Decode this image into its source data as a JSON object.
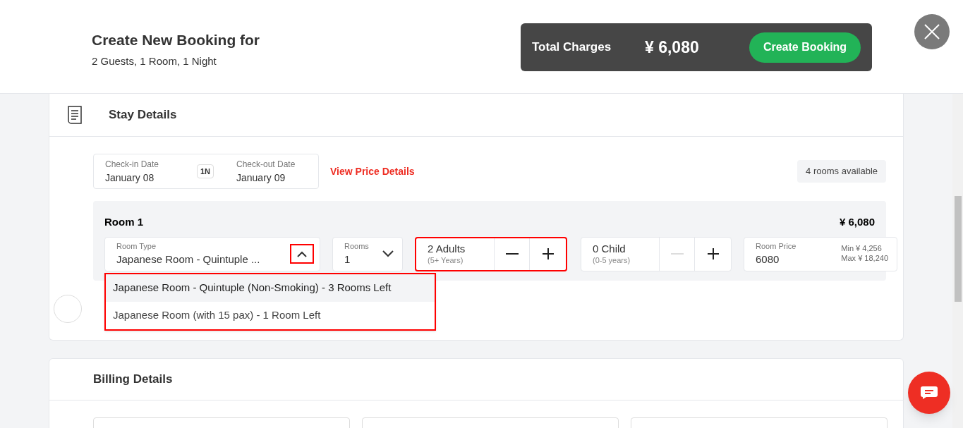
{
  "header": {
    "title": "Create New Booking for",
    "subtitle": "2 Guests, 1 Room, 1 Night"
  },
  "total_bar": {
    "label": "Total Charges",
    "amount": "¥ 6,080",
    "button": "Create Booking"
  },
  "stay_details": {
    "title": "Stay Details",
    "dates": {
      "checkin_label": "Check-in Date",
      "checkin": "January 08",
      "nights": "1N",
      "checkout_label": "Check-out Date",
      "checkout": "January 09"
    },
    "price_link": "View Price Details",
    "availability": "4 rooms available",
    "room": {
      "title": "Room 1",
      "price": "¥ 6,080",
      "room_type": {
        "label": "Room Type",
        "value": "Japanese Room - Quintuple ...",
        "expanded": true,
        "highlighted": true
      },
      "rooms": {
        "label": "Rooms",
        "value": "1"
      },
      "adults": {
        "value": "2 Adults",
        "hint": "(5+ Years)",
        "highlighted": true,
        "minus_disabled": false
      },
      "children": {
        "value": "0 Child",
        "hint": "(0-5 years)",
        "highlighted": false,
        "minus_disabled": true
      },
      "room_price": {
        "label": "Room Price",
        "value": "6080",
        "min": "Min ¥ 4,256",
        "max": "Max ¥ 18,240"
      }
    },
    "dropdown": {
      "highlighted": true,
      "options": [
        {
          "label": "Japanese Room - Quintuple (Non-Smoking) - 3 Rooms Left",
          "selected": true
        },
        {
          "label": "Japanese Room (with 15 pax) - 1 Room Left",
          "selected": false
        }
      ]
    }
  },
  "billing_details": {
    "title": "Billing Details"
  }
}
